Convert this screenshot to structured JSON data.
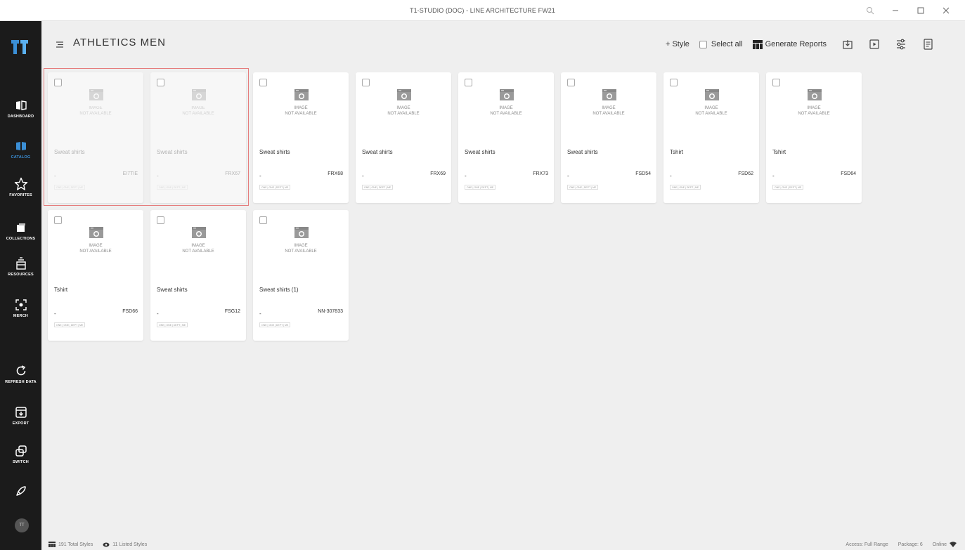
{
  "window": {
    "title": "T1-STUDIO (DOC) - LINE ARCHITECTURE FW21",
    "controls": [
      "zoom-icon",
      "minimize-icon",
      "maximize-icon",
      "close-icon"
    ]
  },
  "sidebar": {
    "items": [
      {
        "label": "DASHBOARD",
        "icon": "dashboard-icon"
      },
      {
        "label": "CATALOG",
        "icon": "catalog-icon",
        "active": true
      },
      {
        "label": "FAVORITES",
        "icon": "star-icon"
      },
      {
        "label": "COLLECTIONS",
        "icon": "collections-icon"
      },
      {
        "label": "RESOURCES",
        "icon": "resources-icon"
      },
      {
        "label": "MERCH",
        "icon": "merch-icon"
      },
      {
        "label": "REFRESH DATA",
        "icon": "refresh-icon"
      },
      {
        "label": "EXPORT",
        "icon": "export-icon"
      },
      {
        "label": "SWITCH",
        "icon": "switch-icon"
      }
    ],
    "avatar_initials": "TT",
    "accent_color": "#3b8fd6"
  },
  "header": {
    "title": "ATHLETICS MEN",
    "add_style_label": "+ Style",
    "select_all_label": "Select all",
    "generate_reports_label": "Generate Reports"
  },
  "image_placeholder": "IMAGE\nNOT AVAILABLE",
  "tag_text": "ONE | ONE | DEPT | ME",
  "cards": [
    {
      "name": "Sweat shirts",
      "dash": "-",
      "code": "EI7TIE",
      "dimmed": true
    },
    {
      "name": "Sweat shirts",
      "dash": "-",
      "code": "FRX67",
      "dimmed": true
    },
    {
      "name": "Sweat shirts",
      "dash": "-",
      "code": "FRX68"
    },
    {
      "name": "Sweat shirts",
      "dash": "-",
      "code": "FRX69"
    },
    {
      "name": "Sweat shirts",
      "dash": "-",
      "code": "FRX73"
    },
    {
      "name": "Sweat shirts",
      "dash": "-",
      "code": "FSD54"
    },
    {
      "name": "Tshirt",
      "dash": "-",
      "code": "FSD62"
    },
    {
      "name": "Tshirt",
      "dash": "-",
      "code": "FSD64"
    },
    {
      "name": "Tshirt",
      "dash": "-",
      "code": "FSD66"
    },
    {
      "name": "Sweat shirts",
      "dash": "-",
      "code": "FSG12"
    },
    {
      "name": "Sweat shirts (1)",
      "dash": "-",
      "code": "NN-307833"
    }
  ],
  "status": {
    "total_styles": "191 Total Styles",
    "listed_styles": "11 Listed Styles",
    "access": "Access: Full Range",
    "package": "Package: 6",
    "online": "Online"
  }
}
